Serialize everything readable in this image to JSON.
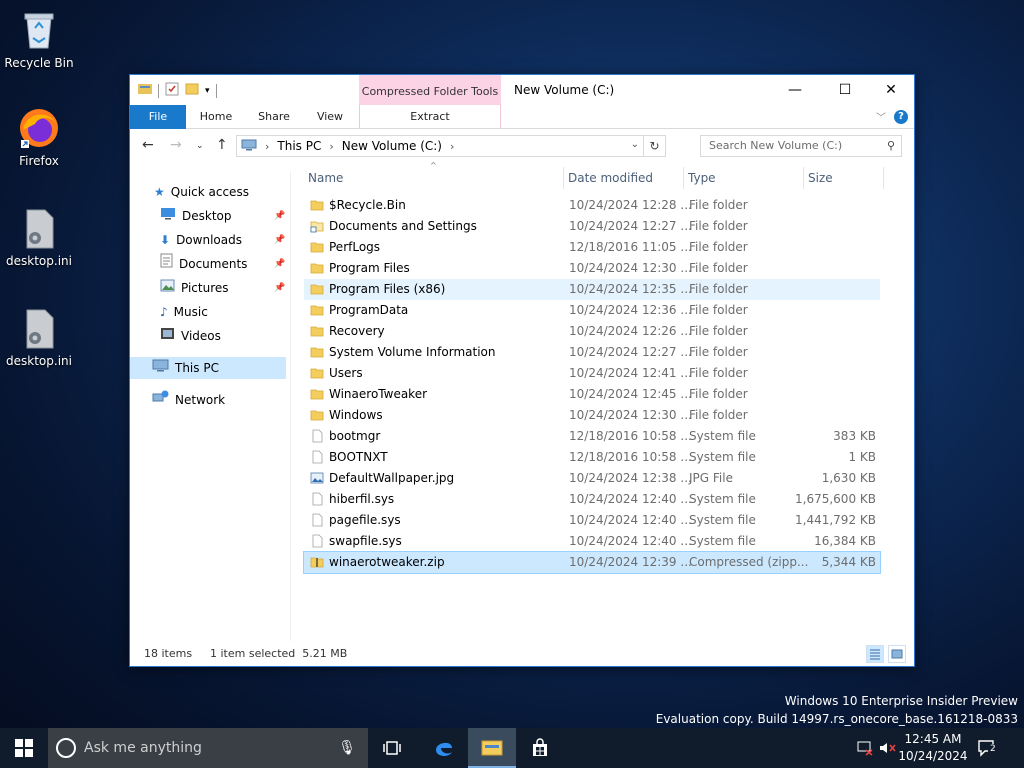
{
  "desktop": {
    "icons": [
      {
        "label": "Recycle Bin",
        "icon": "recycle-bin-icon"
      },
      {
        "label": "Firefox",
        "icon": "firefox-icon"
      },
      {
        "label": "desktop.ini",
        "icon": "config-file-icon"
      },
      {
        "label": "desktop.ini",
        "icon": "config-file-icon"
      }
    ]
  },
  "window": {
    "title": "New Volume (C:)",
    "context_tab": "Compressed Folder Tools",
    "accent_color": "#1979ca",
    "context_color": "#fbd3e4",
    "ribbon_tabs": {
      "file": "File",
      "home": "Home",
      "share": "Share",
      "view": "View",
      "extract": "Extract"
    },
    "controls": {
      "minimize": "—",
      "maximize": "☐",
      "close": "✕"
    }
  },
  "address": {
    "crumbs": [
      "This PC",
      "New Volume (C:)"
    ],
    "search_placeholder": "Search New Volume (C:)"
  },
  "nav": {
    "quick_access": "Quick access",
    "items": [
      {
        "label": "Desktop",
        "icon": "desktop-icon",
        "pinned": true
      },
      {
        "label": "Downloads",
        "icon": "downloads-icon",
        "pinned": true
      },
      {
        "label": "Documents",
        "icon": "documents-icon",
        "pinned": true
      },
      {
        "label": "Pictures",
        "icon": "pictures-icon",
        "pinned": true
      },
      {
        "label": "Music",
        "icon": "music-icon",
        "pinned": false
      },
      {
        "label": "Videos",
        "icon": "videos-icon",
        "pinned": false
      }
    ],
    "this_pc": "This PC",
    "network": "Network"
  },
  "columns": {
    "name": "Name",
    "date": "Date modified",
    "type": "Type",
    "size": "Size"
  },
  "files": [
    {
      "name": "$Recycle.Bin",
      "date": "10/24/2024 12:28 ...",
      "type": "File folder",
      "size": "",
      "kind": "folder"
    },
    {
      "name": "Documents and Settings",
      "date": "10/24/2024 12:27 ...",
      "type": "File folder",
      "size": "",
      "kind": "folder-link"
    },
    {
      "name": "PerfLogs",
      "date": "12/18/2016 11:05 ...",
      "type": "File folder",
      "size": "",
      "kind": "folder"
    },
    {
      "name": "Program Files",
      "date": "10/24/2024 12:30 ...",
      "type": "File folder",
      "size": "",
      "kind": "folder"
    },
    {
      "name": "Program Files (x86)",
      "date": "10/24/2024 12:35 ...",
      "type": "File folder",
      "size": "",
      "kind": "folder"
    },
    {
      "name": "ProgramData",
      "date": "10/24/2024 12:36 ...",
      "type": "File folder",
      "size": "",
      "kind": "folder"
    },
    {
      "name": "Recovery",
      "date": "10/24/2024 12:26 ...",
      "type": "File folder",
      "size": "",
      "kind": "folder"
    },
    {
      "name": "System Volume Information",
      "date": "10/24/2024 12:27 ...",
      "type": "File folder",
      "size": "",
      "kind": "folder"
    },
    {
      "name": "Users",
      "date": "10/24/2024 12:41 ...",
      "type": "File folder",
      "size": "",
      "kind": "folder"
    },
    {
      "name": "WinaeroTweaker",
      "date": "10/24/2024 12:45 ...",
      "type": "File folder",
      "size": "",
      "kind": "folder"
    },
    {
      "name": "Windows",
      "date": "10/24/2024 12:30 ...",
      "type": "File folder",
      "size": "",
      "kind": "folder"
    },
    {
      "name": "bootmgr",
      "date": "12/18/2016 10:58 ...",
      "type": "System file",
      "size": "383 KB",
      "kind": "file"
    },
    {
      "name": "BOOTNXT",
      "date": "12/18/2016 10:58 ...",
      "type": "System file",
      "size": "1 KB",
      "kind": "file"
    },
    {
      "name": "DefaultWallpaper.jpg",
      "date": "10/24/2024 12:38 ...",
      "type": "JPG File",
      "size": "1,630 KB",
      "kind": "image"
    },
    {
      "name": "hiberfil.sys",
      "date": "10/24/2024 12:40 ...",
      "type": "System file",
      "size": "1,675,600 KB",
      "kind": "file"
    },
    {
      "name": "pagefile.sys",
      "date": "10/24/2024 12:40 ...",
      "type": "System file",
      "size": "1,441,792 KB",
      "kind": "file"
    },
    {
      "name": "swapfile.sys",
      "date": "10/24/2024 12:40 ...",
      "type": "System file",
      "size": "16,384 KB",
      "kind": "file"
    },
    {
      "name": "winaerotweaker.zip",
      "date": "10/24/2024 12:39 ...",
      "type": "Compressed (zipp...",
      "size": "5,344 KB",
      "kind": "zip"
    }
  ],
  "status": {
    "count": "18 items",
    "selection": "1 item selected  5.21 MB"
  },
  "watermark": {
    "line1": "Windows 10 Enterprise Insider Preview",
    "line2": "Evaluation copy. Build 14997.rs_onecore_base.161218-0833"
  },
  "taskbar": {
    "search_placeholder": "Ask me anything",
    "time": "12:45 AM",
    "date": "10/24/2024",
    "notification_count": "2"
  }
}
